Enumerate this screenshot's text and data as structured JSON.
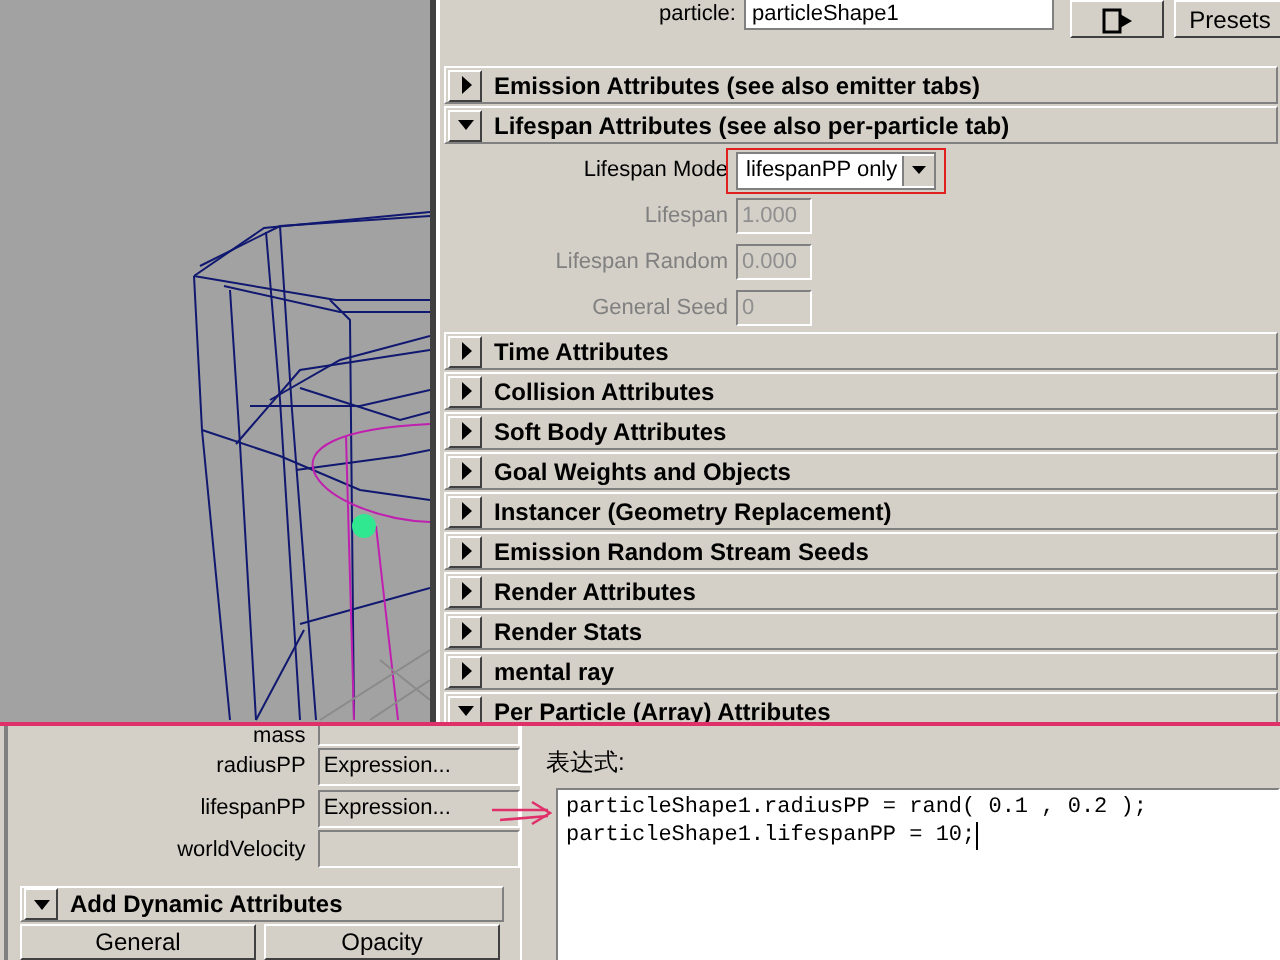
{
  "attribute_editor": {
    "particle_label": "particle:",
    "particle_field": "particleShape1",
    "presets_button": "Presets",
    "sections": [
      {
        "title": "Emission Attributes (see also emitter tabs)",
        "expanded": false
      },
      {
        "title": "Lifespan Attributes (see also per-particle tab)",
        "expanded": true,
        "fields": [
          {
            "label": "Lifespan Mode",
            "value": "lifespanPP only",
            "kind": "dropdown",
            "disabled": false,
            "highlighted": true
          },
          {
            "label": "Lifespan",
            "value": "1.000",
            "kind": "number",
            "disabled": true,
            "highlighted": false
          },
          {
            "label": "Lifespan Random",
            "value": "0.000",
            "kind": "number",
            "disabled": true,
            "highlighted": false
          },
          {
            "label": "General Seed",
            "value": "0",
            "kind": "number",
            "disabled": true,
            "highlighted": false
          }
        ]
      },
      {
        "title": "Time Attributes",
        "expanded": false
      },
      {
        "title": "Collision Attributes",
        "expanded": false
      },
      {
        "title": "Soft Body Attributes",
        "expanded": false
      },
      {
        "title": "Goal Weights and Objects",
        "expanded": false
      },
      {
        "title": "Instancer (Geometry Replacement)",
        "expanded": false
      },
      {
        "title": "Emission Random Stream Seeds",
        "expanded": false
      },
      {
        "title": "Render Attributes",
        "expanded": false
      },
      {
        "title": "Render Stats",
        "expanded": false
      },
      {
        "title": "mental ray",
        "expanded": false
      },
      {
        "title": "Per Particle (Array) Attributes",
        "expanded": true
      }
    ]
  },
  "per_particle_panel": {
    "rows": [
      {
        "label": "mass"
      },
      {
        "label": "radiusPP",
        "value": "Expression..."
      },
      {
        "label": "lifespanPP",
        "value": "Expression..."
      },
      {
        "label": "worldVelocity"
      }
    ],
    "section": {
      "title": "Add Dynamic Attributes",
      "expanded": true
    },
    "buttons": [
      "General",
      "Opacity"
    ]
  },
  "expression_editor": {
    "label": "表达式:",
    "lines": [
      "particleShape1.radiusPP = rand( 0.1 , 0.2 );",
      "particleShape1.lifespanPP = 10;"
    ]
  }
}
